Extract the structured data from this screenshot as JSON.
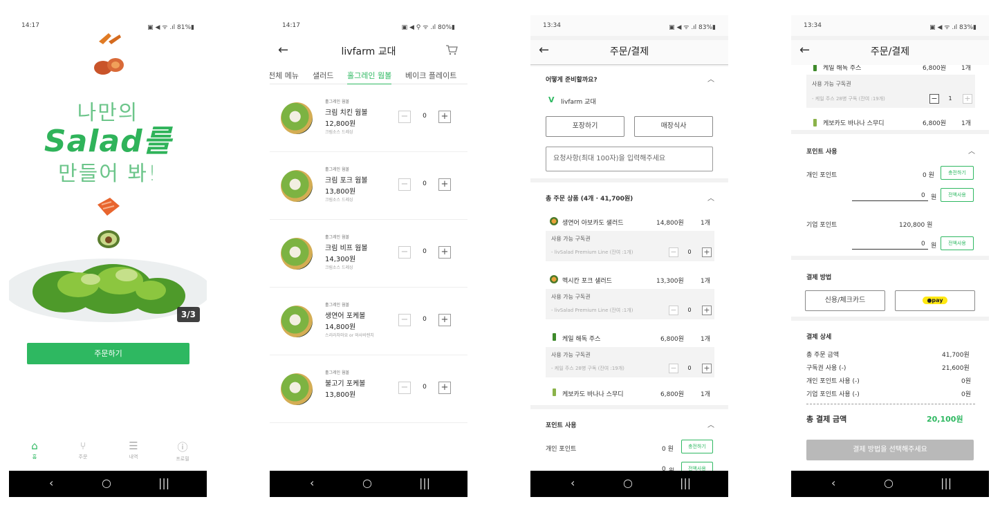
{
  "status": {
    "s1_time": "14:17",
    "s2_time": "14:17",
    "s3_time": "13:34",
    "s4_time": "13:34",
    "s1_sys": "▣ ◀ ᯤ .ıl 81%▮",
    "s2_sys": "▣ ◀ ⚲ ᯤ .ıl 80%▮",
    "s3_sys": "▣ ◀ ᯤ .ıl 83%▮",
    "s4_sys": "▣ ◀ ᯤ .ıl 83%▮"
  },
  "navbar": {
    "back": "‹",
    "home": "○",
    "recent": "|||"
  },
  "home": {
    "hero_line1": "나만의",
    "hero_line2": "Salad를",
    "hero_line3": "만들어 봐!",
    "slide_counter": "3/3",
    "order_button": "주문하기",
    "tabs": [
      {
        "icon": "⌂",
        "label": "홈"
      },
      {
        "icon": "⑂",
        "label": "주문"
      },
      {
        "icon": "☰",
        "label": "내역"
      },
      {
        "icon": "ⓘ",
        "label": "프로필"
      }
    ]
  },
  "menu": {
    "store_title": "livfarm 교대",
    "categories": [
      "전체 메뉴",
      "샐러드",
      "홀그레인 웜볼",
      "베이크 플레이트"
    ],
    "items": [
      {
        "category": "홀그레인 웜볼",
        "name": "크림 치킨 웜볼",
        "price": "12,800원",
        "desc": "크림소스 드레싱",
        "qty": "0"
      },
      {
        "category": "홀그레인 웜볼",
        "name": "크림 포크 웜볼",
        "price": "13,800원",
        "desc": "크림소스 드레싱",
        "qty": "0"
      },
      {
        "category": "홀그레인 웜볼",
        "name": "크림 비프 웜볼",
        "price": "14,300원",
        "desc": "크림소스 드레싱",
        "qty": "0"
      },
      {
        "category": "홀그레인 웜볼",
        "name": "생연어 포케볼",
        "price": "14,800원",
        "desc": "스리라차마요 or 와사비렌치",
        "qty": "0"
      },
      {
        "category": "홀그레인 웜볼",
        "name": "불고기 포케볼",
        "price": "13,800원",
        "desc": "",
        "qty": "0"
      }
    ]
  },
  "checkout": {
    "title": "주문/결제",
    "prep_title": "어떻게 준비할까요?",
    "store_logo": "V",
    "store_name": "livfarm 교대",
    "takeout": "포장하기",
    "dine_in": "매장식사",
    "request_placeholder": "요청사항(최대 100자)을 입력해주세요",
    "order_summary": "총 주문 상품 (4개 · 41,700원)",
    "items": [
      {
        "name": "생연어 아보카도 샐러드",
        "price": "14,800원",
        "count": "1개",
        "sub_label": "사용 가능 구독권",
        "sub_option": "- livSalad Premium Line (잔여 :1개)",
        "sub_qty": "0"
      },
      {
        "name": "멕시칸 포크 샐러드",
        "price": "13,300원",
        "count": "1개",
        "sub_label": "사용 가능 구독권",
        "sub_option": "- livSalad Premium Line (잔여 :1개)",
        "sub_qty": "0"
      },
      {
        "name": "케일 해독 주스",
        "price": "6,800원",
        "count": "1개",
        "sub_label": "사용 가능 구독권",
        "sub_option": "- 케일 주스 28병 구독 (잔여 :19개)",
        "sub_qty": "0"
      },
      {
        "name": "케보카도 바나나 스무디",
        "price": "6,800원",
        "count": "1개"
      }
    ],
    "points_title": "포인트 사용",
    "personal_points": "개인 포인트",
    "personal_points_value": "0 원",
    "charge": "충전하기",
    "use_all": "전액사용",
    "points_input_value": "0",
    "won": "원"
  },
  "payment": {
    "title": "주문/결제",
    "juice_name": "케일 해독 주스",
    "juice_price": "6,800원",
    "juice_count": "1개",
    "sub_label": "사용 가능 구독권",
    "sub_option": "- 케일 주스 28병 구독 (잔여 :19개)",
    "sub_qty": "1",
    "smoothie_name": "케보카도 바나나 스무디",
    "smoothie_price": "6,800원",
    "smoothie_count": "1개",
    "points_title": "포인트 사용",
    "personal_points": "개인 포인트",
    "personal_points_value": "0 원",
    "charge": "충전하기",
    "use_all": "전액사용",
    "personal_input": "0",
    "corp_points": "기업 포인트",
    "corp_points_value": "120,800 원",
    "corp_input": "0",
    "won": "원",
    "method_title": "결제 방법",
    "card": "신용/체크카드",
    "kakao": "●pay",
    "detail_title": "결제 상세",
    "details": [
      {
        "label": "총 주문 금액",
        "value": "41,700원"
      },
      {
        "label": "구독권 사용 (-)",
        "value": "21,600원"
      },
      {
        "label": "개인 포인트 사용 (-)",
        "value": "0원"
      },
      {
        "label": "기업 포인트 사용 (-)",
        "value": "0원"
      }
    ],
    "total_label": "총 결제 금액",
    "total_value": "20,100원",
    "pay_button": "결제 방법을 선택해주세요"
  },
  "colors": {
    "brand_green": "#2eb861",
    "disabled_gray": "#b9b9b9",
    "kakao_yellow": "#ffe812"
  }
}
